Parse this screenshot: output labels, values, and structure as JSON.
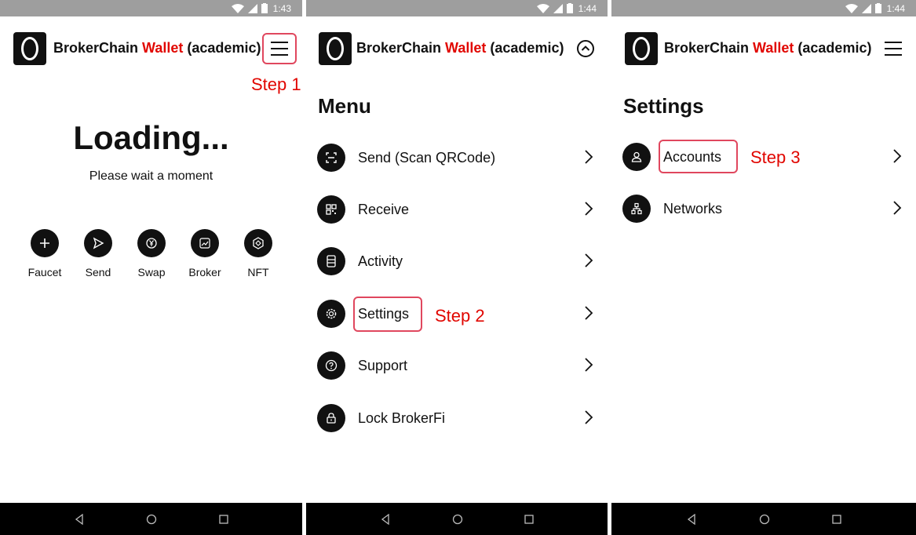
{
  "screens": [
    {
      "status_time": "1:43",
      "brand": {
        "name": "BrokerChain",
        "accent": "Wallet",
        "suffix": "(academic)"
      },
      "step_label": "Step 1",
      "title": "Loading...",
      "subtitle": "Please wait a moment",
      "actions": [
        {
          "label": "Faucet",
          "icon": "plus-icon"
        },
        {
          "label": "Send",
          "icon": "send-icon"
        },
        {
          "label": "Swap",
          "icon": "swap-yen-icon"
        },
        {
          "label": "Broker",
          "icon": "chart-icon"
        },
        {
          "label": "NFT",
          "icon": "nft-icon"
        }
      ]
    },
    {
      "status_time": "1:44",
      "brand": {
        "name": "BrokerChain",
        "accent": "Wallet",
        "suffix": "(academic)"
      },
      "title": "Menu",
      "step_label": "Step 2",
      "items": [
        {
          "label": "Send (Scan QRCode)",
          "icon": "scan-icon"
        },
        {
          "label": "Receive",
          "icon": "qrcode-icon"
        },
        {
          "label": "Activity",
          "icon": "activity-list-icon"
        },
        {
          "label": "Settings",
          "icon": "gear-icon"
        },
        {
          "label": "Support",
          "icon": "help-icon"
        },
        {
          "label": "Lock BrokerFi",
          "icon": "lock-icon"
        }
      ]
    },
    {
      "status_time": "1:44",
      "brand": {
        "name": "BrokerChain",
        "accent": "Wallet",
        "suffix": "(academic)"
      },
      "title": "Settings",
      "step_label": "Step 3",
      "items": [
        {
          "label": "Accounts",
          "icon": "user-icon"
        },
        {
          "label": "Networks",
          "icon": "network-icon"
        }
      ]
    }
  ],
  "colors": {
    "accent": "#e10600",
    "highlight": "#e0475e",
    "status_bar": "#9e9e9e",
    "nav_bar": "#000000"
  }
}
